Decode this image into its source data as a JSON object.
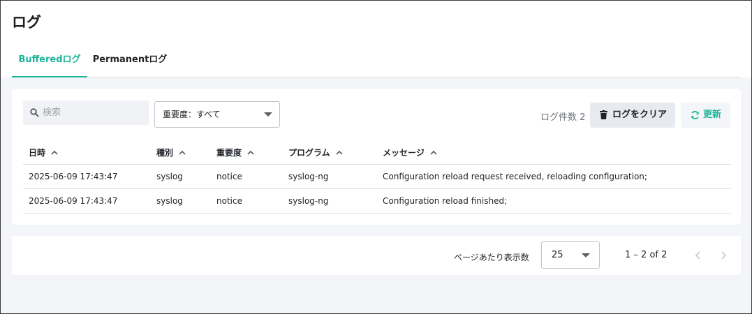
{
  "page": {
    "title": "ログ"
  },
  "tabs": [
    {
      "label": "Bufferedログ",
      "active": true
    },
    {
      "label": "Permanentログ",
      "active": false
    }
  ],
  "toolbar": {
    "search_placeholder": "検索",
    "severity_filter": "重要度：すべて",
    "log_count": "ログ件数 2",
    "clear_label": "ログをクリア",
    "refresh_label": "更新"
  },
  "table": {
    "columns": [
      "日時",
      "種別",
      "重要度",
      "プログラム",
      "メッセージ"
    ],
    "rows": [
      [
        "2025-06-09 17:43:47",
        "syslog",
        "notice",
        "syslog-ng",
        "Configuration reload request received, reloading configuration;"
      ],
      [
        "2025-06-09 17:43:47",
        "syslog",
        "notice",
        "syslog-ng",
        "Configuration reload finished;"
      ]
    ]
  },
  "pagination": {
    "per_page_label": "ページあたり表示数",
    "per_page_value": "25",
    "range": "1 – 2 of 2"
  },
  "colors": {
    "accent": "#1bb59a",
    "background": "#f4f5f8"
  },
  "icons": [
    "search-icon",
    "trash-icon",
    "refresh-icon",
    "sort-asc-icon",
    "chevron-left-icon",
    "chevron-right-icon",
    "caret-down-icon"
  ]
}
